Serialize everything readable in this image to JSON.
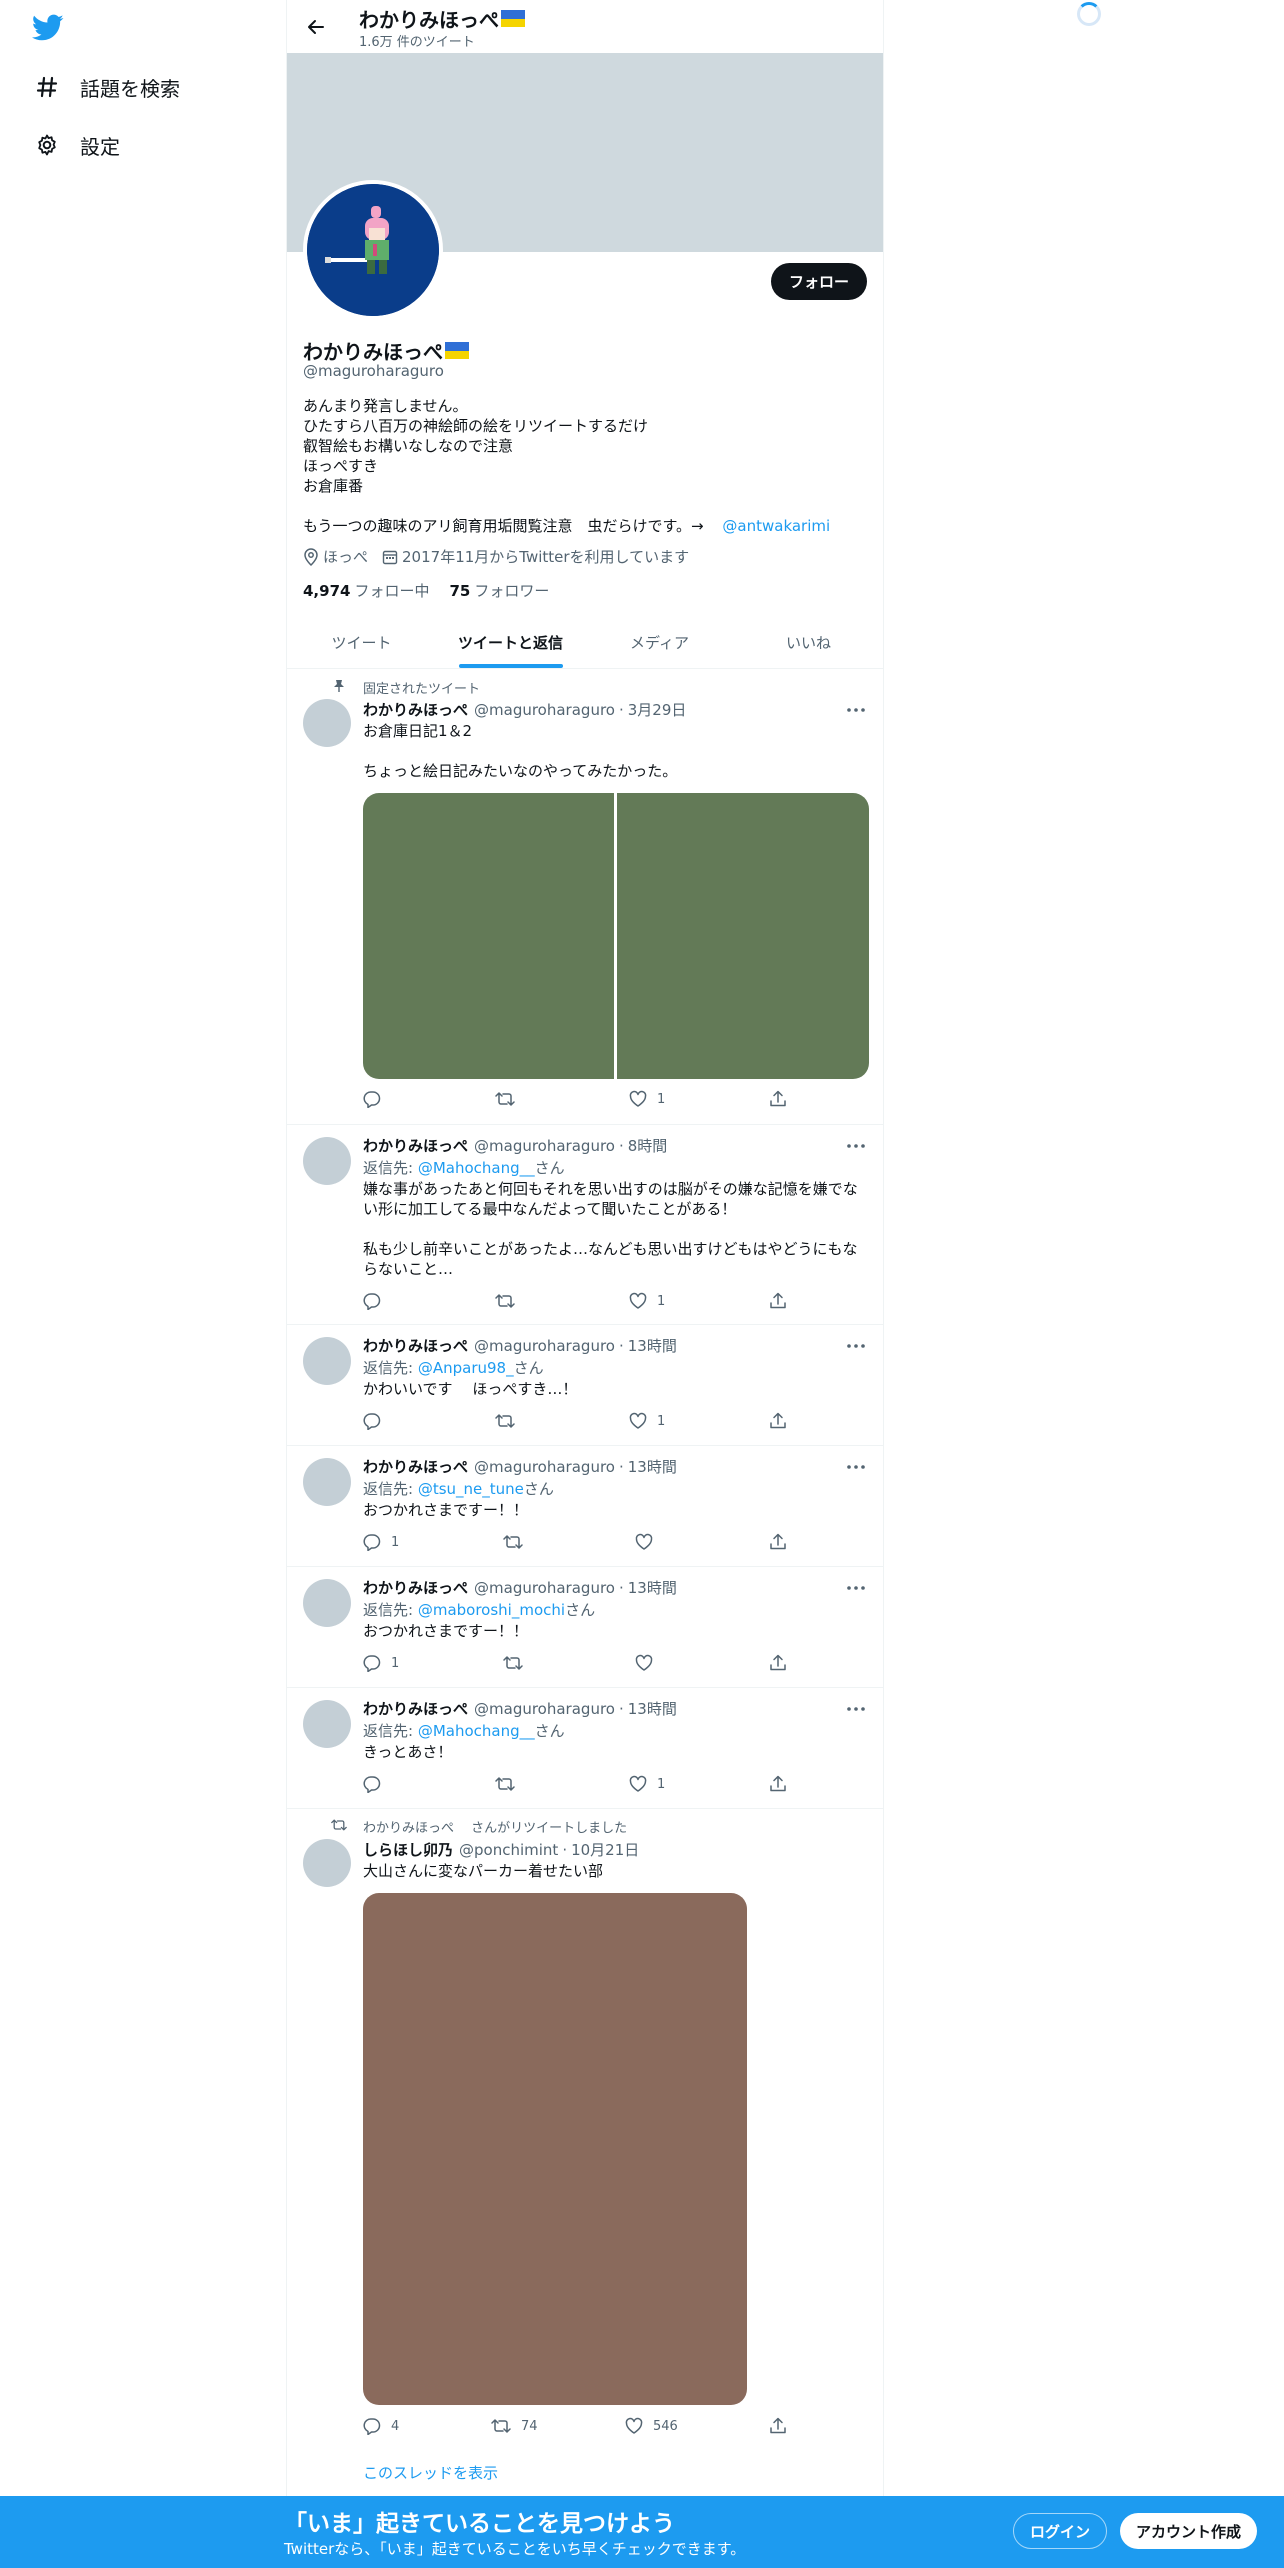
{
  "nav": {
    "logo": "twitter-bird-icon",
    "items": [
      {
        "icon": "hashtag-icon",
        "label": "話題を検索"
      },
      {
        "icon": "gear-icon",
        "label": "設定"
      }
    ]
  },
  "header": {
    "title": "わかりみほっぺ",
    "tweet_count": "1.6万 件のツイート"
  },
  "profile": {
    "name": "わかりみほっぺ",
    "handle": "@maguroharaguro",
    "follow_label": "フォロー",
    "bio_lines": [
      "あんまり発言しません。",
      "ひたすら八百万の神絵師の絵をリツイートするだけ",
      "叡智絵もお構いなしなので注意",
      "ほっぺすき",
      "お倉庫番"
    ],
    "bio_extra": "もう一つの趣味のアリ飼育用垢閲覧注意　虫だらけです。→",
    "bio_link": "@antwakarimi",
    "location": "ほっぺ",
    "joined": "2017年11月からTwitterを利用しています",
    "following_count": "4,974",
    "following_label": "フォロー中",
    "followers_count": "75",
    "followers_label": "フォロワー"
  },
  "tabs": [
    "ツイート",
    "ツイートと返信",
    "メディア",
    "いいね"
  ],
  "active_tab": "ツイートと返信",
  "tweets": [
    {
      "social": "固定されたツイート",
      "name": "わかりみほっぺ",
      "handle": "@maguroharaguro",
      "time": "3月29日",
      "lines": [
        "お倉庫日記1＆2",
        "",
        "ちょっと絵日記みたいなのやってみたかった。"
      ],
      "likes": "1"
    },
    {
      "name": "わかりみほっぺ",
      "handle": "@maguroharaguro",
      "time": "8時間",
      "reply_label": "返信先:",
      "reply_to": "@Mahochang__",
      "reply_suffix": "さん",
      "lines": [
        "嫌な事があったあと何回もそれを思い出すのは脳がその嫌な記憶を嫌でな",
        "い形に加工してる最中なんだよって聞いたことがある！",
        "",
        "私も少し前辛いことがあったよ…なんども思い出すけどもはやどうにもな",
        "らないこと…"
      ],
      "likes": "1"
    },
    {
      "name": "わかりみほっぺ",
      "handle": "@maguroharaguro",
      "time": "13時間",
      "reply_label": "返信先:",
      "reply_to": "@Anparu98_",
      "reply_suffix": "さん",
      "lines": [
        "かわいいです　 ほっぺすき…！"
      ],
      "likes": "1"
    },
    {
      "name": "わかりみほっぺ",
      "handle": "@maguroharaguro",
      "time": "13時間",
      "reply_label": "返信先:",
      "reply_to": "@tsu_ne_tune",
      "reply_suffix": "さん",
      "lines": [
        "おつかれさまですー！！"
      ],
      "replies": "1"
    },
    {
      "name": "わかりみほっぺ",
      "handle": "@maguroharaguro",
      "time": "13時間",
      "reply_label": "返信先:",
      "reply_to": "@maboroshi_mochi",
      "reply_suffix": "さん",
      "lines": [
        "おつかれさまですー！！"
      ],
      "replies": "1"
    },
    {
      "name": "わかりみほっぺ",
      "handle": "@maguroharaguro",
      "time": "13時間",
      "reply_label": "返信先:",
      "reply_to": "@Mahochang__",
      "reply_suffix": "さん",
      "lines": [
        "きっとあさ！"
      ],
      "likes": "1"
    },
    {
      "social": "わかりみほっぺ　 さんがリツイートしました",
      "name": "しらほし卯乃",
      "handle": "@ponchimint",
      "time": "10月21日",
      "lines": [
        "大山さんに変なパーカー着せたい部"
      ],
      "replies": "4",
      "retweets": "74",
      "likes": "546",
      "show_thread": "このスレッドを表示"
    }
  ],
  "bottom_bar": {
    "title": "「いま」起きていることを見つけよう",
    "subtitle": "Twitterなら、「いま」起きていることをいち早くチェックできます。",
    "login": "ログイン",
    "signup": "アカウント作成"
  },
  "colors": {
    "accent": "#1d9bf0",
    "banner": "#cfd9de",
    "media_green": "#637a57",
    "media_brown": "#8a6a5c"
  }
}
